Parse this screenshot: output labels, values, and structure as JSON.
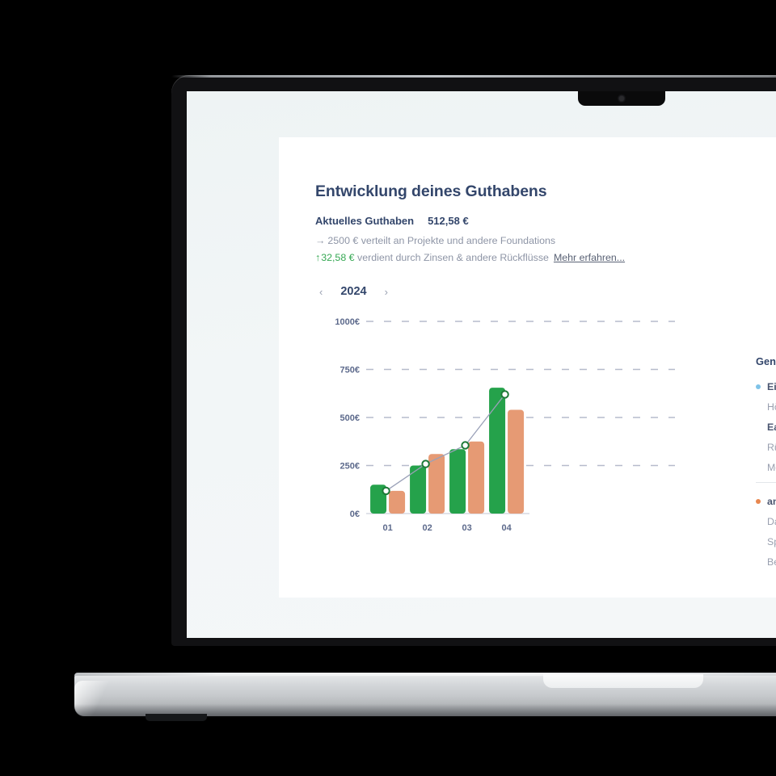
{
  "card": {
    "title": "Entwicklung deines Guthabens",
    "balance_label": "Aktuelles Guthaben",
    "balance_value": "512,58 €",
    "sub_line_1_arrow": "→",
    "sub_line_1": "2500 € verteilt an Projekte und andere Foundations",
    "sub_line_2_arrow": "↑",
    "sub_line_2_amount": "32,58 €",
    "sub_line_2": "verdient durch Zinsen & andere Rückflüsse",
    "more_link": "Mehr erfahren..."
  },
  "year_nav": {
    "prev_icon": "‹",
    "next_icon": "›",
    "year": "2024"
  },
  "side_panel": {
    "title": "General overview",
    "groups": [
      {
        "dot_color": "#7fc3e8",
        "heading": "Einzahlungen",
        "items": [
          {
            "label": "Höhe Spendenbescheinigung",
            "bold": false
          },
          {
            "label": "Earnings",
            "bold": true
          },
          {
            "label": "Rückflüsse aus Finaznzanlagen",
            "bold": false
          },
          {
            "label": "Monthly interest from account",
            "bold": false
          }
        ]
      },
      {
        "dot_color": "#e8874f",
        "heading": "an Organisationen und Projekte",
        "items": [
          {
            "label": "Darlehen",
            "bold": false
          },
          {
            "label": "Spenden",
            "bold": false
          },
          {
            "label": "Beteiligungen",
            "bold": false
          }
        ]
      }
    ]
  },
  "colors": {
    "green": "#25a24b",
    "orange": "#e69a74",
    "axis_text": "#5d6a8c",
    "grid": "#8b93ad",
    "line": "#9aa1b8",
    "heading": "#33466b",
    "muted": "#9aa0b0",
    "card_bg": "#ffffff",
    "screen_bg": "#f1f5f6"
  },
  "chart_data": {
    "type": "bar",
    "title": "",
    "xlabel": "",
    "ylabel": "",
    "categories": [
      "01",
      "02",
      "03",
      "04"
    ],
    "ytick_labels": [
      "0€",
      "250€",
      "500€",
      "750€",
      "1000€"
    ],
    "yticks": [
      0,
      250,
      500,
      750,
      1000
    ],
    "ylim": [
      0,
      1070
    ],
    "grid": true,
    "grid_style": "dashed",
    "legend_position": "right",
    "series": [
      {
        "name": "Einzahlungen",
        "color": "#25a24b",
        "values": [
          150,
          250,
          335,
          655
        ]
      },
      {
        "name": "an Organisationen und Projekte",
        "color": "#e69a74",
        "values": [
          118,
          310,
          375,
          540
        ]
      },
      {
        "name": "Guthaben",
        "type": "line",
        "color": "#9aa1b8",
        "marker_color": "#1e7a38",
        "values": [
          118,
          258,
          355,
          620
        ]
      }
    ]
  }
}
